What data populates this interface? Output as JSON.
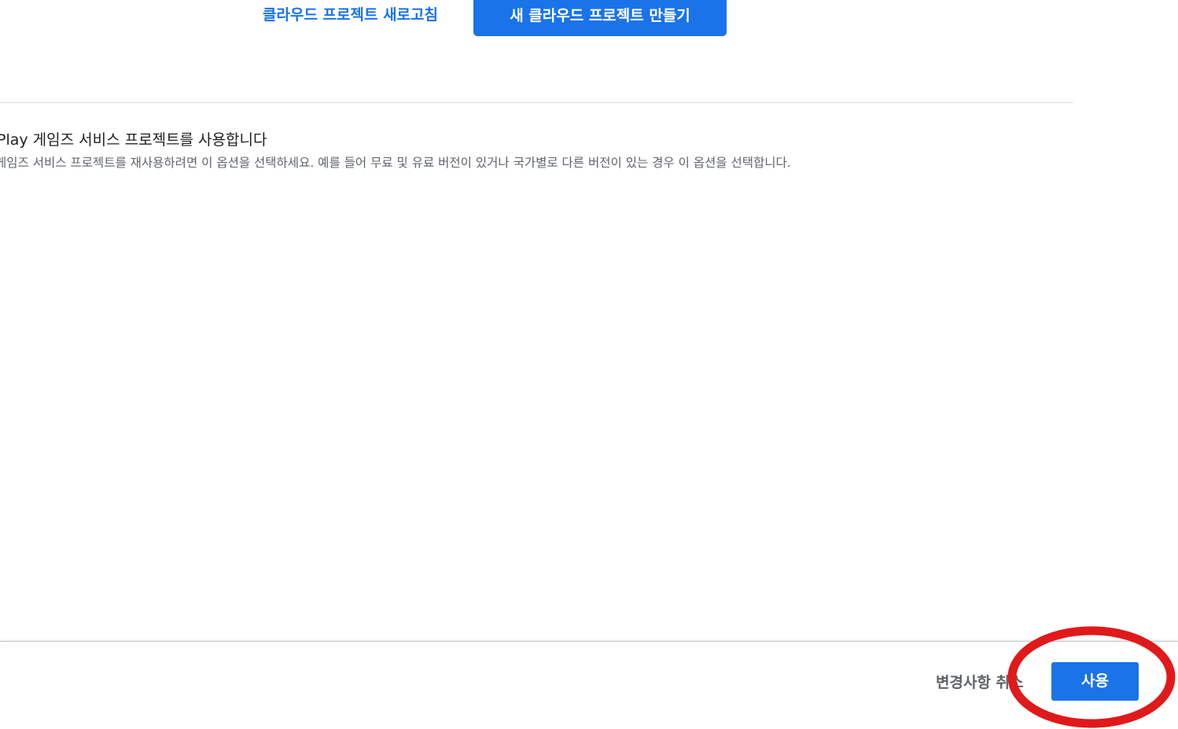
{
  "top_actions": {
    "refresh_label": "클라우드 프로젝트 새로고침",
    "create_label": "새 클라우드 프로젝트 만들기"
  },
  "option": {
    "title": "Play 게임즈 서비스 프로젝트를 사용합니다",
    "description": "게임즈 서비스 프로젝트를 재사용하려면 이 옵션을 선택하세요. 예를 들어 무료 및 유료 버전이 있거나 국가별로 다른 버전이 있는 경우 이 옵션을 선택합니다."
  },
  "footer": {
    "cancel_label": "변경사항 취소",
    "apply_label": "사용"
  },
  "colors": {
    "accent": "#1a73e8",
    "annotation": "#e0191b"
  }
}
